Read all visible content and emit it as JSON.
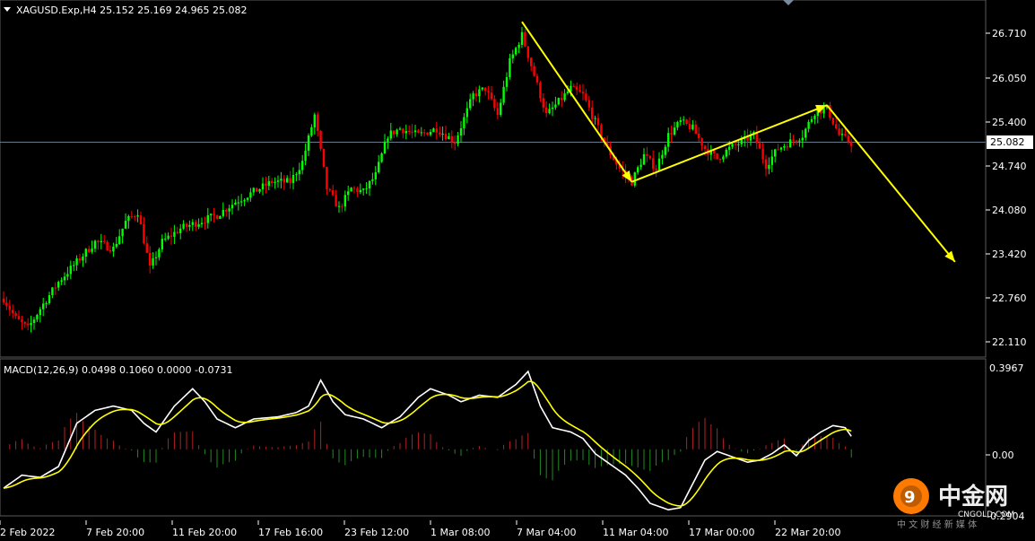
{
  "header": {
    "symbol_line": "XAGUSD.Exp,H4  25.152 25.169 24.965 25.082",
    "macd_line": "MACD(12,26,9) 0.0498 0.1060 0.0000 -0.0731"
  },
  "price_axis": {
    "labels": [
      "26.710",
      "26.050",
      "25.400",
      "24.740",
      "24.080",
      "23.420",
      "22.760",
      "22.110"
    ],
    "current_price": "25.082"
  },
  "macd_axis": {
    "labels": [
      "0.3967",
      "0.00",
      "-0.2904"
    ]
  },
  "time_axis": {
    "labels": [
      "2 Feb 2022",
      "7 Feb 20:00",
      "11 Feb 20:00",
      "17 Feb 16:00",
      "23 Feb 12:00",
      "1 Mar 08:00",
      "7 Mar 04:00",
      "11 Mar 04:00",
      "17 Mar 00:00",
      "22 Mar 20:00"
    ]
  },
  "watermark": {
    "brand": "中金网",
    "url": "CNGOLD.COM",
    "tagline": "中 文 财 经 新 媒 体"
  },
  "colors": {
    "bull": "#00ff00",
    "bear": "#ff0000",
    "arrow": "#ffff00",
    "macd_line": "#ffffff",
    "signal_line": "#ffff00",
    "hist_pos": "#b22222",
    "hist_neg": "#228b22"
  },
  "chart_data": {
    "type": "candlestick",
    "price_range": [
      21.9,
      27.2
    ],
    "macd_range": [
      -0.3,
      0.41
    ],
    "price_anchors": [
      [
        0,
        22.75
      ],
      [
        4,
        22.45
      ],
      [
        8,
        22.3
      ],
      [
        12,
        22.6
      ],
      [
        18,
        23.0
      ],
      [
        24,
        23.3
      ],
      [
        30,
        23.6
      ],
      [
        36,
        23.5
      ],
      [
        40,
        23.9
      ],
      [
        44,
        24.05
      ],
      [
        48,
        23.2
      ],
      [
        52,
        23.6
      ],
      [
        58,
        23.8
      ],
      [
        64,
        23.9
      ],
      [
        70,
        24.0
      ],
      [
        76,
        24.2
      ],
      [
        82,
        24.35
      ],
      [
        88,
        24.5
      ],
      [
        94,
        24.5
      ],
      [
        98,
        24.8
      ],
      [
        102,
        25.5
      ],
      [
        106,
        24.4
      ],
      [
        110,
        24.1
      ],
      [
        114,
        24.4
      ],
      [
        118,
        24.35
      ],
      [
        122,
        24.6
      ],
      [
        126,
        25.2
      ],
      [
        130,
        25.3
      ],
      [
        136,
        25.2
      ],
      [
        142,
        25.3
      ],
      [
        148,
        25.1
      ],
      [
        154,
        25.8
      ],
      [
        158,
        25.9
      ],
      [
        162,
        25.5
      ],
      [
        166,
        26.3
      ],
      [
        170,
        26.7
      ],
      [
        174,
        26.1
      ],
      [
        178,
        25.5
      ],
      [
        182,
        25.7
      ],
      [
        186,
        25.9
      ],
      [
        190,
        25.8
      ],
      [
        194,
        25.4
      ],
      [
        198,
        25.0
      ],
      [
        202,
        24.7
      ],
      [
        206,
        24.5
      ],
      [
        210,
        24.9
      ],
      [
        214,
        24.7
      ],
      [
        218,
        25.2
      ],
      [
        222,
        25.4
      ],
      [
        226,
        25.3
      ],
      [
        230,
        25.0
      ],
      [
        234,
        24.85
      ],
      [
        238,
        25.0
      ],
      [
        242,
        25.1
      ],
      [
        246,
        25.2
      ],
      [
        250,
        24.75
      ],
      [
        254,
        25.0
      ],
      [
        258,
        25.1
      ],
      [
        262,
        25.2
      ],
      [
        266,
        25.55
      ],
      [
        270,
        25.6
      ],
      [
        274,
        25.2
      ],
      [
        278,
        25.08
      ]
    ],
    "macd_anchors": [
      [
        0,
        -0.18
      ],
      [
        6,
        -0.12
      ],
      [
        12,
        -0.13
      ],
      [
        18,
        -0.08
      ],
      [
        24,
        0.12
      ],
      [
        30,
        0.18
      ],
      [
        36,
        0.2
      ],
      [
        42,
        0.18
      ],
      [
        46,
        0.12
      ],
      [
        50,
        0.08
      ],
      [
        56,
        0.2
      ],
      [
        62,
        0.28
      ],
      [
        66,
        0.22
      ],
      [
        70,
        0.14
      ],
      [
        76,
        0.1
      ],
      [
        82,
        0.14
      ],
      [
        90,
        0.15
      ],
      [
        96,
        0.17
      ],
      [
        100,
        0.2
      ],
      [
        104,
        0.32
      ],
      [
        108,
        0.22
      ],
      [
        112,
        0.16
      ],
      [
        118,
        0.14
      ],
      [
        124,
        0.1
      ],
      [
        130,
        0.15
      ],
      [
        136,
        0.24
      ],
      [
        140,
        0.28
      ],
      [
        146,
        0.25
      ],
      [
        150,
        0.22
      ],
      [
        156,
        0.25
      ],
      [
        162,
        0.24
      ],
      [
        168,
        0.3
      ],
      [
        172,
        0.36
      ],
      [
        176,
        0.2
      ],
      [
        180,
        0.1
      ],
      [
        186,
        0.08
      ],
      [
        190,
        0.05
      ],
      [
        194,
        -0.02
      ],
      [
        198,
        -0.06
      ],
      [
        204,
        -0.12
      ],
      [
        208,
        -0.18
      ],
      [
        212,
        -0.25
      ],
      [
        218,
        -0.28
      ],
      [
        222,
        -0.27
      ],
      [
        226,
        -0.16
      ],
      [
        230,
        -0.05
      ],
      [
        234,
        -0.01
      ],
      [
        238,
        -0.03
      ],
      [
        244,
        -0.06
      ],
      [
        248,
        -0.05
      ],
      [
        252,
        -0.02
      ],
      [
        256,
        0.02
      ],
      [
        260,
        -0.03
      ],
      [
        264,
        0.04
      ],
      [
        268,
        0.08
      ],
      [
        272,
        0.11
      ],
      [
        276,
        0.1
      ],
      [
        278,
        0.06
      ]
    ],
    "arrows": [
      {
        "from": [
          170,
          26.9
        ],
        "to": [
          206,
          24.5
        ]
      },
      {
        "from": [
          206,
          24.5
        ],
        "to": [
          270,
          25.65
        ]
      },
      {
        "from": [
          270,
          25.65
        ],
        "to": [
          312,
          23.3
        ]
      }
    ]
  }
}
